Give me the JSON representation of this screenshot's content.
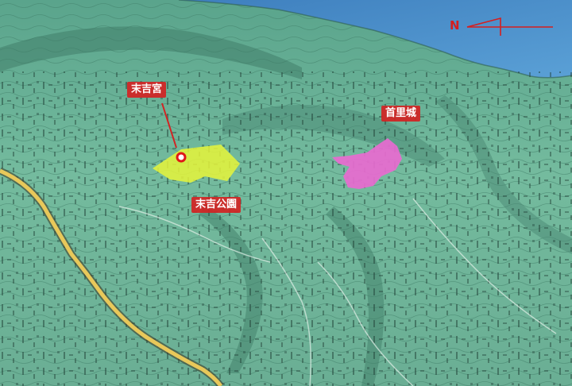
{
  "map": {
    "labels": {
      "sueyoshi_gu": "末吉宮",
      "shuri_castle": "首里城",
      "sueyoshi_park": "末吉公園"
    },
    "north_arrow": {
      "letter": "N"
    },
    "colors": {
      "terrain": "#6fb79a",
      "terrain_dark": "#4f8f7a",
      "sea": "#4f8fcb",
      "road": "#e8c85a",
      "park_highlight": "#e6f53a",
      "castle_highlight": "#e86ad0",
      "marker": "#e01818",
      "label_bg": "#d22323",
      "label_text": "#ffffff"
    },
    "icons": {
      "shrine_marker": "circle-marker-icon",
      "north": "north-arrow-icon"
    }
  }
}
